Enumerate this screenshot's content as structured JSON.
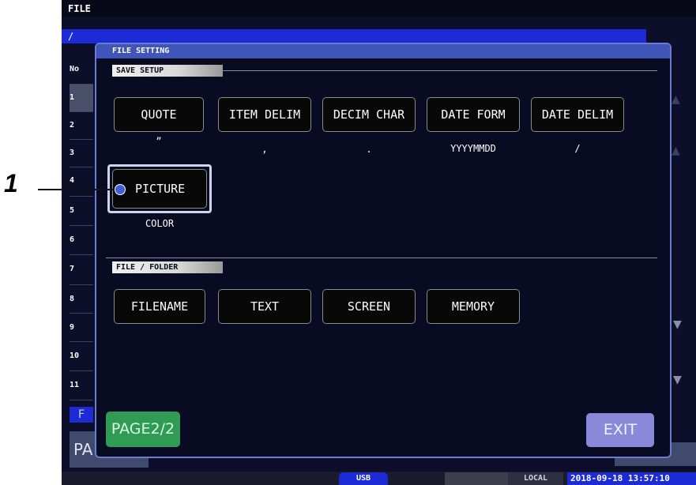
{
  "screen": {
    "title": "FILE",
    "path": "/",
    "row_header": "No",
    "rows": [
      "1",
      "2",
      "3",
      "4",
      "5",
      "6",
      "7",
      "8",
      "9",
      "10",
      "11"
    ],
    "bottom_left_tab": "F",
    "bottom_left_button": "PA"
  },
  "status_bar": {
    "usb": "USB",
    "local": "LOCAL",
    "datetime": "2018-09-18 13:57:10"
  },
  "dialog": {
    "title": "FILE SETTING",
    "save_setup": {
      "header": "SAVE SETUP",
      "buttons": [
        {
          "label": "QUOTE",
          "value": "”"
        },
        {
          "label": "ITEM DELIM",
          "value": ","
        },
        {
          "label": "DECIM CHAR",
          "value": "."
        },
        {
          "label": "DATE FORM",
          "value": "YYYYMMDD"
        },
        {
          "label": "DATE DELIM",
          "value": "/"
        }
      ],
      "picture": {
        "label": "PICTURE",
        "value": "COLOR"
      }
    },
    "file_folder": {
      "header": "FILE / FOLDER",
      "buttons": [
        "FILENAME",
        "TEXT",
        "SCREEN",
        "MEMORY"
      ]
    },
    "page_label": "PAGE2/2",
    "exit_label": "EXIT"
  },
  "callout": {
    "number": "1"
  },
  "colors": {
    "screen_bg": "#0c0e2a",
    "title_bar": "#3f55b8",
    "path_bar": "#1c2bd6",
    "page_button": "#2f9b55",
    "exit_button": "#8a88d8",
    "callout_dot": "#3f61d8"
  }
}
